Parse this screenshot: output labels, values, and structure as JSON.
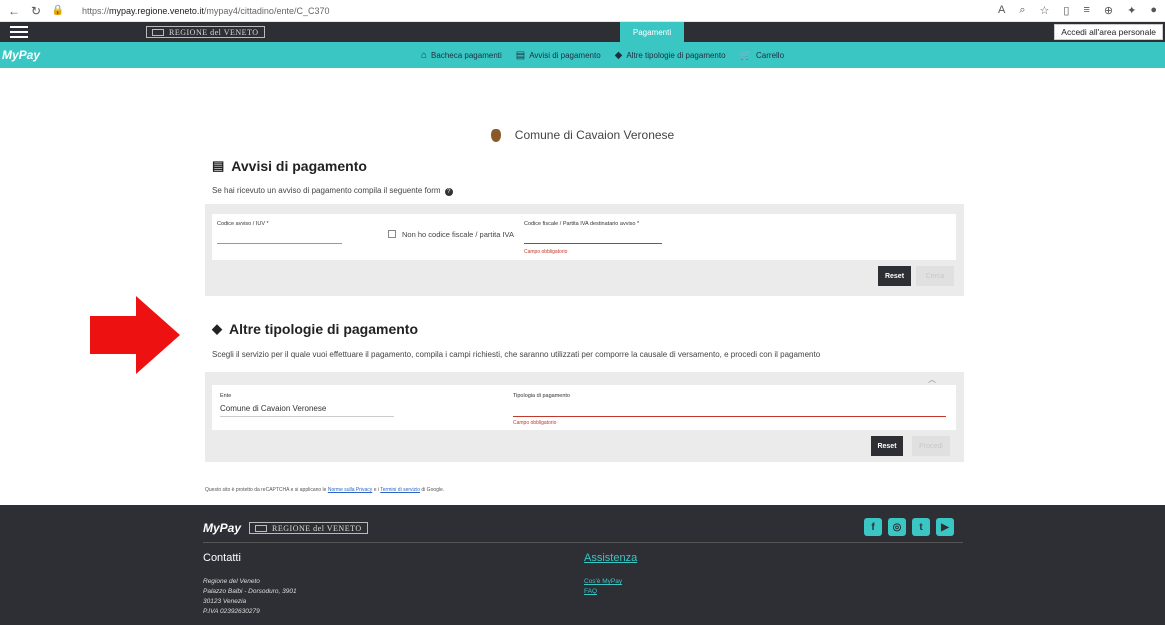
{
  "browser": {
    "url_prefix": "https://",
    "url_domain": "mypay.regione.veneto.it",
    "url_path": "/mypay4/cittadino/ente/C_C370"
  },
  "topbar": {
    "regione": "REGIONE del VENETO",
    "active_tab": "Pagamenti",
    "login_button": "Accedi all'area personale"
  },
  "mainnav": {
    "logo": "MyPay",
    "items": [
      {
        "label": "Bacheca pagamenti",
        "icon": "home-icon"
      },
      {
        "label": "Avvisi di pagamento",
        "icon": "document-icon"
      },
      {
        "label": "Altre tipologie di pagamento",
        "icon": "tag-icon"
      },
      {
        "label": "Carrello",
        "icon": "cart-icon"
      }
    ]
  },
  "ente": {
    "name": "Comune di Cavaion Veronese"
  },
  "avvisi": {
    "title": "Avvisi di pagamento",
    "description": "Se hai ricevuto un avviso di pagamento compila il seguente form",
    "codice_label": "Codice avviso / IUV *",
    "no_cf_label": "Non ho codice fiscale / partita IVA",
    "cf_label": "Codice fiscale / Partita IVA destinatario avviso *",
    "cf_error": "Campo obbligatorio",
    "reset": "Reset",
    "search": "Cerca"
  },
  "altre": {
    "title": "Altre tipologie di pagamento",
    "description": "Scegli il servizio per il quale vuoi effettuare il pagamento, compila i campi richiesti, che saranno utilizzati per comporre la causale di versamento, e procedi con il pagamento",
    "ente_label": "Ente",
    "ente_value": "Comune di Cavaion Veronese",
    "tipologia_label": "Tipologia di pagamento",
    "tipologia_error": "Campo obbligatorio",
    "reset": "Reset",
    "procedi": "Procedi"
  },
  "recaptcha": {
    "text_before": "Questo sito è protetto da reCAPTCHA e si applicano le ",
    "privacy": "Norme sulla Privacy",
    "middle": " e i ",
    "terms": "Termini di servizio",
    "text_after": " di Google."
  },
  "footer": {
    "logo": "MyPay",
    "regione": "REGIONE del VENETO",
    "contatti": "Contatti",
    "assistenza": "Assistenza",
    "address": [
      "Regione del Veneto",
      "Palazzo Balbi - Dorsoduro, 3901",
      "30123 Venezia",
      "P.IVA 02392630279"
    ],
    "links": [
      "Cos'è MyPay",
      "FAQ"
    ]
  }
}
